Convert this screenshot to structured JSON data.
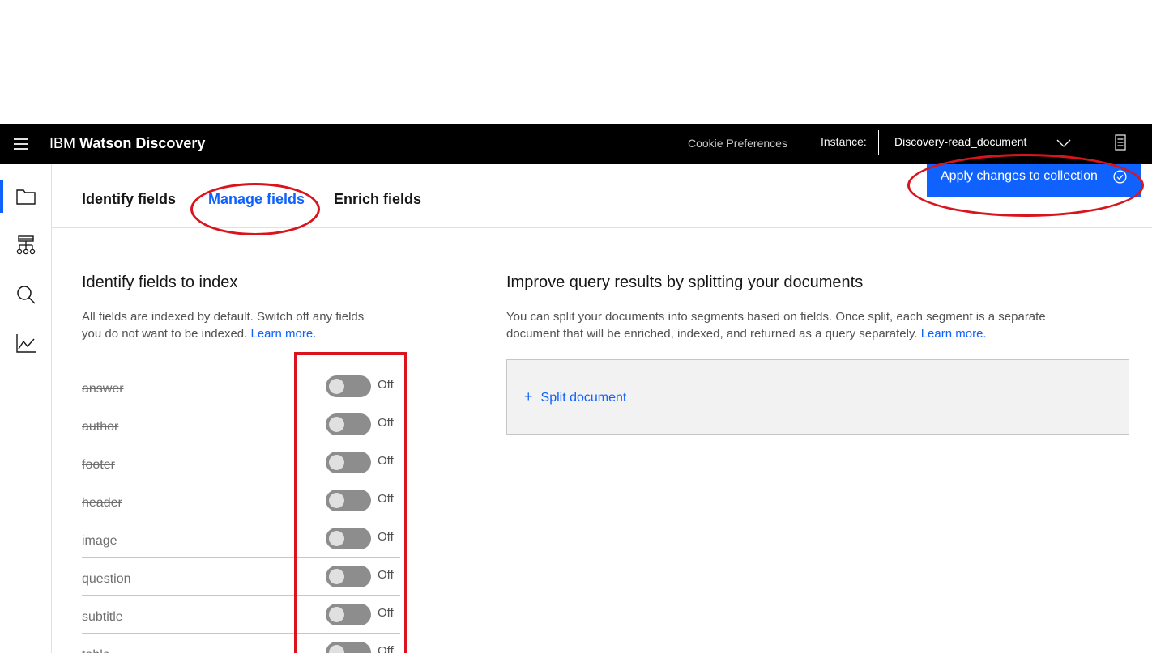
{
  "header": {
    "brand_prefix": "IBM",
    "brand_name": "Watson Discovery",
    "cookie_label": "Cookie Preferences",
    "instance_label": "Instance:",
    "instance_value": "Discovery-read_document"
  },
  "rail": {
    "icons": [
      "folder-icon",
      "hierarchy-icon",
      "search-icon",
      "chart-line-icon"
    ]
  },
  "tabs": [
    {
      "label": "Identify fields",
      "active": false
    },
    {
      "label": "Manage fields",
      "active": true
    },
    {
      "label": "Enrich fields",
      "active": false
    }
  ],
  "apply_button": {
    "label": "Apply changes to collection",
    "icon": "checkmark-circle-icon"
  },
  "index_section": {
    "title": "Identify fields to index",
    "desc_line1": "All fields are indexed by default. Switch off any fields",
    "desc_line2": "you do not want to be indexed.",
    "learn_more": "Learn more.",
    "fields": [
      {
        "name": "answer",
        "state": "Off"
      },
      {
        "name": "author",
        "state": "Off"
      },
      {
        "name": "footer",
        "state": "Off"
      },
      {
        "name": "header",
        "state": "Off"
      },
      {
        "name": "image",
        "state": "Off"
      },
      {
        "name": "question",
        "state": "Off"
      },
      {
        "name": "subtitle",
        "state": "Off"
      },
      {
        "name": "table",
        "state": "Off"
      }
    ]
  },
  "split_section": {
    "title": "Improve query results by splitting your documents",
    "desc_line1": "You can split your documents into segments based on fields. Once split, each segment is a separate",
    "desc_line2": "document that will be enriched, indexed, and returned as a query separately.",
    "learn_more": "Learn more.",
    "split_button": "Split document"
  },
  "colors": {
    "accent": "#0f62fe",
    "topbar": "#000000",
    "annotation": "#d9141c"
  }
}
